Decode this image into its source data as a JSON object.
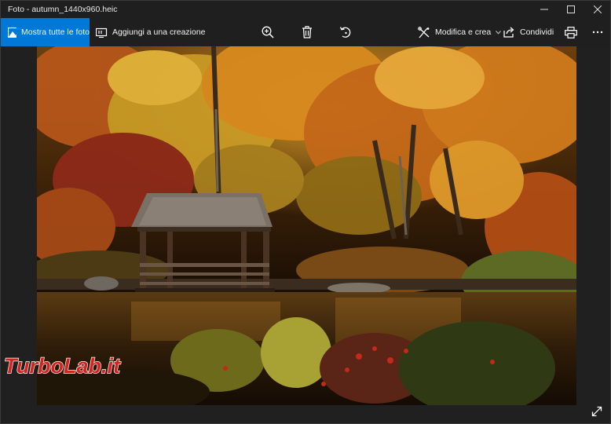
{
  "window": {
    "title": "Foto - autumn_1440x960.heic"
  },
  "titlebar": {
    "minimize_icon": "minimize-icon",
    "maximize_icon": "maximize-icon",
    "close_icon": "close-icon"
  },
  "toolbar": {
    "show_all_label": "Mostra tutte le foto",
    "add_creation_label": "Aggiungi a una creazione",
    "edit_create_label": "Modifica e crea",
    "share_label": "Condividi",
    "icons": [
      "zoom-in-icon",
      "trash-icon",
      "rotate-icon",
      "print-icon",
      "more-icon"
    ],
    "accent_color": "#0078d7"
  },
  "viewer": {
    "image_file": "autumn_1440x960.heic",
    "fullscreen_icon": "expand-icon"
  },
  "watermark": {
    "text": "TurboLab.it"
  }
}
